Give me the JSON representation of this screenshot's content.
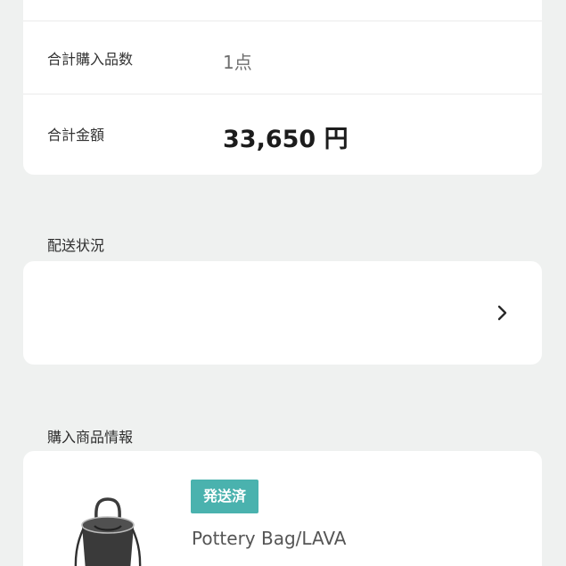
{
  "summary": {
    "total_quantity_label": "合計購入品数",
    "total_quantity_value": "1点",
    "total_amount_label": "合計金額",
    "total_amount_value": "33,650 円"
  },
  "shipping": {
    "section_title": "配送状況",
    "chevron_icon": "chevron-right-icon"
  },
  "purchased_items": {
    "section_title": "購入商品情報",
    "items": [
      {
        "status": "発送済",
        "name": "Pottery Bag/LAVA",
        "image_icon": "bucket-bag-image"
      }
    ]
  },
  "colors": {
    "page_background": "#eff1f0",
    "card_background": "#ffffff",
    "status_badge": "#4ab2ae"
  }
}
